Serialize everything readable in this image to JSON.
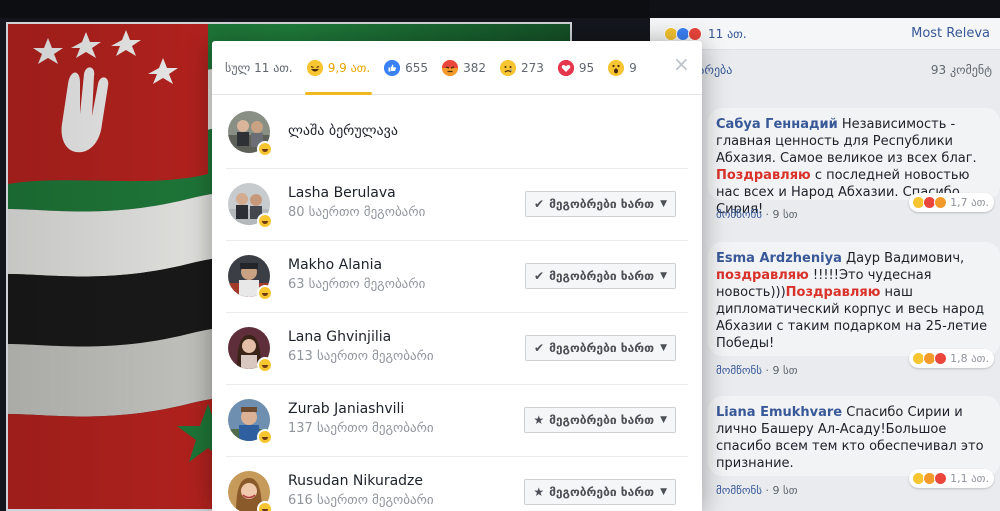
{
  "modal": {
    "tabs": [
      {
        "label": "სულ 11 ათ.",
        "icon": "all"
      },
      {
        "label": "9,9 ათ.",
        "icon": "haha-icon",
        "active": true
      },
      {
        "label": "655",
        "icon": "like-icon"
      },
      {
        "label": "382",
        "icon": "angry-icon"
      },
      {
        "label": "273",
        "icon": "sad-icon"
      },
      {
        "label": "95",
        "icon": "love-icon"
      },
      {
        "label": "9",
        "icon": "wow-icon"
      }
    ],
    "close": "×",
    "people": [
      {
        "name": "ლაშა ბერულავა",
        "mutual": "",
        "button": ""
      },
      {
        "name": "Lasha Berulava",
        "mutual": "80 საერთო მეგობარი",
        "button": "მეგობრები ხართ",
        "icon": "check-icon"
      },
      {
        "name": "Makho Alania",
        "mutual": "63 საერთო მეგობარი",
        "button": "მეგობრები ხართ",
        "icon": "check-icon"
      },
      {
        "name": "Lana Ghvinjilia",
        "mutual": "613 საერთო მეგობარი",
        "button": "მეგობრები ხართ",
        "icon": "check-icon"
      },
      {
        "name": "Zurab Janiashvili",
        "mutual": "137 საერთო მეგობარი",
        "button": "მეგობრები ხართ",
        "icon": "star-icon"
      },
      {
        "name": "Rusudan Nikuradze",
        "mutual": "616 საერთო მეგობარი",
        "button": "მეგობრები ხართ",
        "icon": "star-icon"
      }
    ]
  },
  "comments_panel": {
    "reaction_count": "11 ათ.",
    "sort": "Most Releva",
    "more_comments": "აზიარება",
    "total_comments": "93 კომენტ",
    "comments": [
      {
        "author": "Сабуа Геннадий",
        "text1": " Независимость - главная ценность для Республики Абхазия. Самое великое из всех благ. ",
        "highlight": "Поздравляю",
        "text2": " с последней новостью нас всех и Народ Абхазии. Спасибо Сирия!",
        "reactions": "1,7 ათ.",
        "meta_like": "მომწონს",
        "meta_time": " · 9 სთ"
      },
      {
        "author": "Esma Ardzheniya",
        "text1": " Даур Вадимович, ",
        "highlight": "поздравляю",
        "text2": " !!!!!Это чудесная новость)))",
        "highlight2": "Поздравляю",
        "text3": " наш дипломатический корпус и весь народ Абхазии с таким подарком на 25-летие Победы!",
        "reactions": "1,8 ათ.",
        "meta_like": "მომწონს",
        "meta_time": " · 9 სთ"
      },
      {
        "author": "Liana Emukhvare",
        "text1": " Спасибо Сирии и лично Башеру Ал-Асаду!Большое спасибо всем тем кто обеспечивал это признание.",
        "reactions": "1,1 ათ.",
        "meta_like": "მომწონს",
        "meta_time": " · 9 სთ"
      }
    ]
  },
  "colors": {
    "accent_tab": "#f0b81e",
    "link": "#385898",
    "highlight": "#d9322a"
  }
}
